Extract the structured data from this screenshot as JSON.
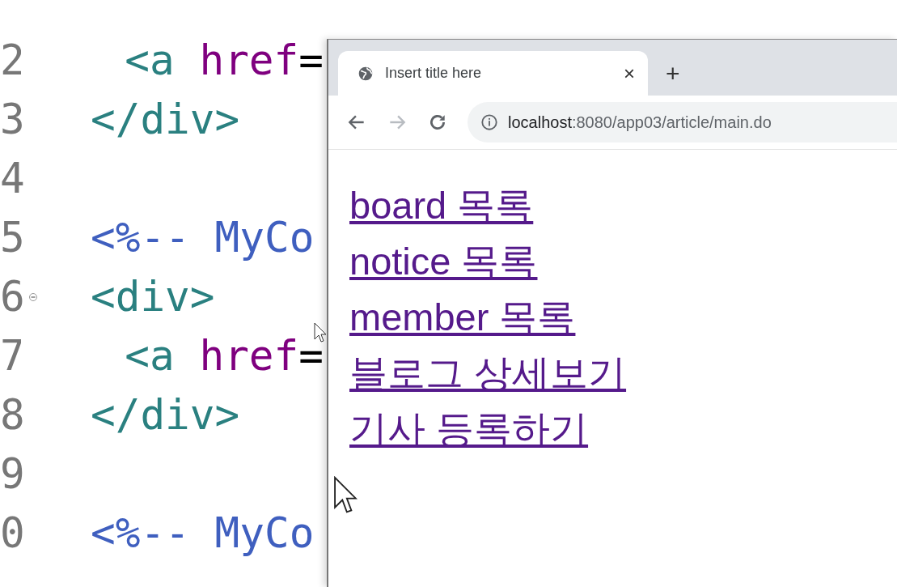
{
  "editor": {
    "lines": [
      {
        "number": "2",
        "fold": false,
        "tokens": [
          {
            "text": "  <a",
            "kind": "tag"
          },
          {
            "text": " href",
            "kind": "attr"
          },
          {
            "text": "=",
            "kind": "punct"
          }
        ]
      },
      {
        "number": "3",
        "fold": false,
        "tokens": [
          {
            "text": "</div>",
            "kind": "tag"
          }
        ]
      },
      {
        "number": "4",
        "fold": false
      },
      {
        "number": "5",
        "fold": false,
        "tokens": [
          {
            "text": "<%-- MyCo",
            "kind": "comment"
          }
        ]
      },
      {
        "number": "6",
        "fold": true,
        "tokens": [
          {
            "text": "<div>",
            "kind": "tag"
          }
        ]
      },
      {
        "number": "7",
        "fold": false,
        "tokens": [
          {
            "text": "  <a",
            "kind": "tag"
          },
          {
            "text": " href",
            "kind": "attr"
          },
          {
            "text": "=",
            "kind": "punct"
          }
        ]
      },
      {
        "number": "8",
        "fold": false,
        "tokens": [
          {
            "text": "</div>",
            "kind": "tag"
          }
        ]
      },
      {
        "number": "9",
        "fold": false
      },
      {
        "number": "0",
        "fold": false,
        "tokens": [
          {
            "text": "<%-- MyCo",
            "kind": "comment"
          }
        ]
      }
    ]
  },
  "browser": {
    "tabs": [
      {
        "title": "Insert title here",
        "selected": true,
        "close": "×"
      }
    ],
    "new_tab": "+",
    "nav": [
      {
        "kind": "back",
        "disabled": false
      },
      {
        "kind": "forward",
        "disabled": true
      },
      {
        "kind": "reload",
        "disabled": false
      }
    ],
    "address": {
      "host": "localhost",
      "path": ":8080/app03/article/main.do"
    },
    "links": [
      "board 목록",
      "notice 목록",
      "member 목록",
      "블로그 상세보기",
      "기사 등록하기"
    ]
  }
}
